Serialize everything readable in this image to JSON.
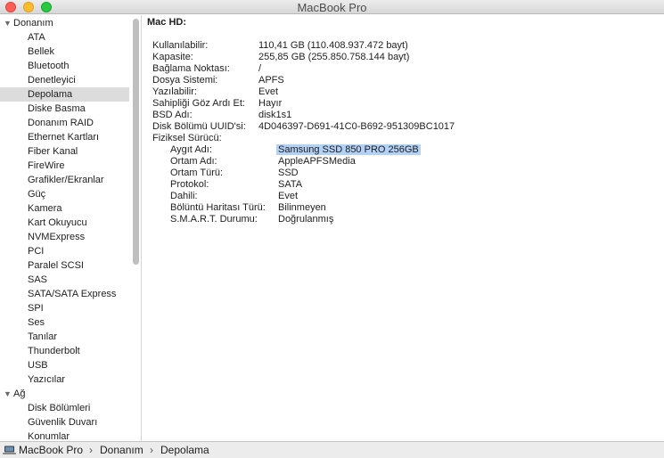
{
  "window": {
    "title": "MacBook Pro"
  },
  "sidebar": {
    "groups": [
      {
        "label": "Donanım",
        "items": [
          "ATA",
          "Bellek",
          "Bluetooth",
          "Denetleyici",
          "Depolama",
          "Diske Basma",
          "Donanım RAID",
          "Ethernet Kartları",
          "Fiber Kanal",
          "FireWire",
          "Grafikler/Ekranlar",
          "Güç",
          "Kamera",
          "Kart Okuyucu",
          "NVMExpress",
          "PCI",
          "Paralel SCSI",
          "SAS",
          "SATA/SATA Express",
          "SPI",
          "Ses",
          "Tanılar",
          "Thunderbolt",
          "USB",
          "Yazıcılar"
        ]
      },
      {
        "label": "Ağ",
        "items": [
          "Disk Bölümleri",
          "Güvenlik Duvarı",
          "Konumlar"
        ]
      }
    ],
    "selected": "Depolama"
  },
  "detail": {
    "heading": "Mac HD:",
    "props": [
      {
        "key": "Kullanılabilir:",
        "value": "110,41 GB (110.408.937.472 bayt)"
      },
      {
        "key": "Kapasite:",
        "value": "255,85 GB (255.850.758.144 bayt)"
      },
      {
        "key": "Bağlama Noktası:",
        "value": "/"
      },
      {
        "key": "Dosya Sistemi:",
        "value": "APFS"
      },
      {
        "key": "Yazılabilir:",
        "value": "Evet"
      },
      {
        "key": "Sahipliği Göz Ardı Et:",
        "value": "Hayır"
      },
      {
        "key": "BSD Adı:",
        "value": "disk1s1"
      },
      {
        "key": "Disk Bölümü UUID'si:",
        "value": "4D046397-D691-41C0-B692-951309BC1017"
      },
      {
        "key": "Fiziksel Sürücü:",
        "value": ""
      }
    ],
    "drive": [
      {
        "key": "Aygıt Adı:",
        "value": "Samsung SSD 850 PRO 256GB"
      },
      {
        "key": "Ortam Adı:",
        "value": "AppleAPFSMedia"
      },
      {
        "key": "Ortam Türü:",
        "value": "SSD"
      },
      {
        "key": "Protokol:",
        "value": "SATA"
      },
      {
        "key": "Dahili:",
        "value": "Evet"
      },
      {
        "key": "Bölüntü Haritası Türü:",
        "value": "Bilinmeyen"
      },
      {
        "key": "S.M.A.R.T. Durumu:",
        "value": "Doğrulanmış"
      }
    ]
  },
  "statusbar": {
    "crumbs": [
      "MacBook Pro",
      "Donanım",
      "Depolama"
    ],
    "separator": "›"
  },
  "icons": {
    "laptop": "laptop-icon",
    "disclosure": "disclosure-triangle-icon"
  },
  "colors": {
    "selection_highlight": "#b3d1f5",
    "selected_row": "#dcdcdc"
  }
}
